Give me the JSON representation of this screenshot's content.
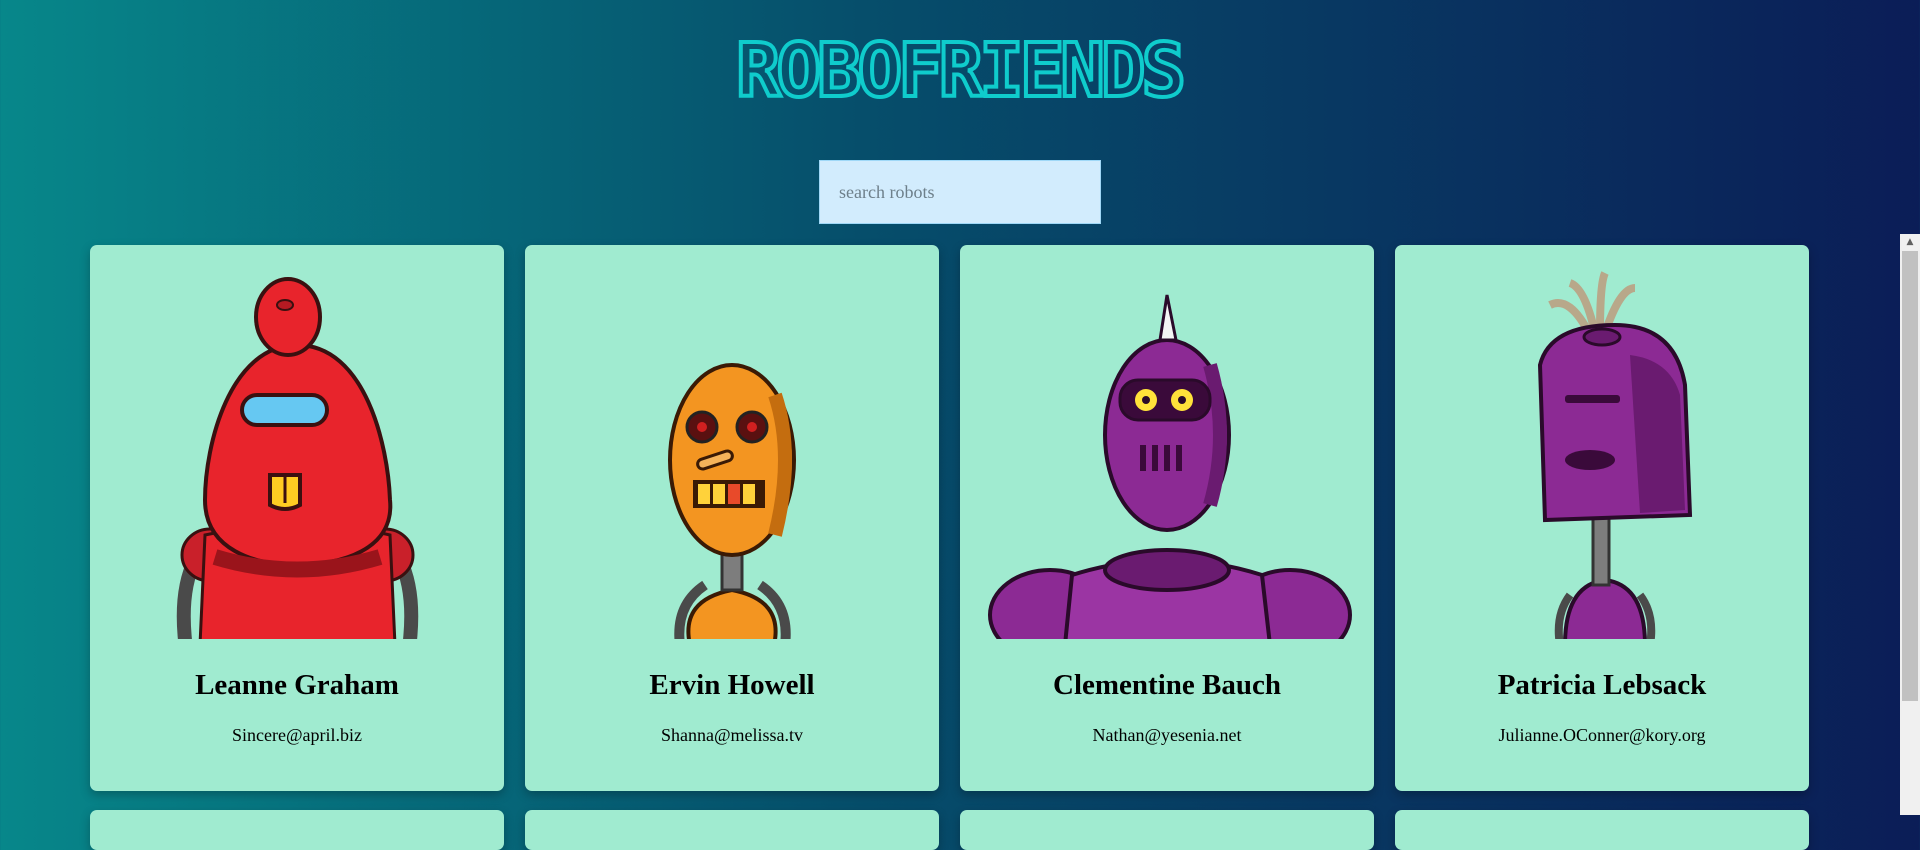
{
  "header": {
    "title": "ROBOFRIENDS"
  },
  "search": {
    "placeholder": "search robots",
    "value": ""
  },
  "robots": [
    {
      "name": "Leanne Graham",
      "email": "Sincere@april.biz",
      "color": "#e8242c"
    },
    {
      "name": "Ervin Howell",
      "email": "Shanna@melissa.tv",
      "color": "#f39521"
    },
    {
      "name": "Clementine Bauch",
      "email": "Nathan@yesenia.net",
      "color": "#8c2a94"
    },
    {
      "name": "Patricia Lebsack",
      "email": "Julianne.OConner@kory.org",
      "color": "#8c2a94"
    }
  ],
  "colors": {
    "card_background": "#a0ebd0",
    "title_color": "#0fcccc",
    "search_background": "#d2ecfd"
  }
}
